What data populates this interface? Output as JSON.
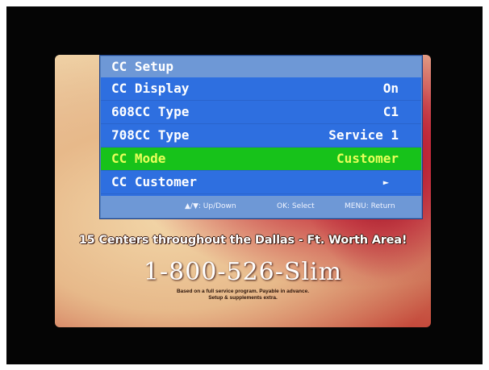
{
  "osd": {
    "title": "CC Setup",
    "rows": [
      {
        "label": "CC Display",
        "value": "On"
      },
      {
        "label": "608CC Type",
        "value": "C1"
      },
      {
        "label": "708CC Type",
        "value": "Service 1"
      },
      {
        "label": "CC Mode",
        "value": "Customer"
      },
      {
        "label": "CC Customer",
        "value": "►"
      }
    ],
    "selected_row": "CC Mode",
    "footer": {
      "nav_hint": "▲/▼: Up/Down",
      "ok_hint": "OK: Select",
      "menu_hint": "MENU: Return"
    }
  },
  "background_ad": {
    "tagline": "15 Centers throughout the Dallas - Ft. Worth Area!",
    "phone": "1-800-526-Slim",
    "fineprint_line1": "Based on a full service program. Payable in advance.",
    "fineprint_line2": "Setup & supplements extra."
  },
  "colors": {
    "menu_bg": "#2e6fe0",
    "menu_header_bg": "#6e98d6",
    "selected_bg": "#17c21a",
    "selected_text": "#e8ff5a"
  }
}
